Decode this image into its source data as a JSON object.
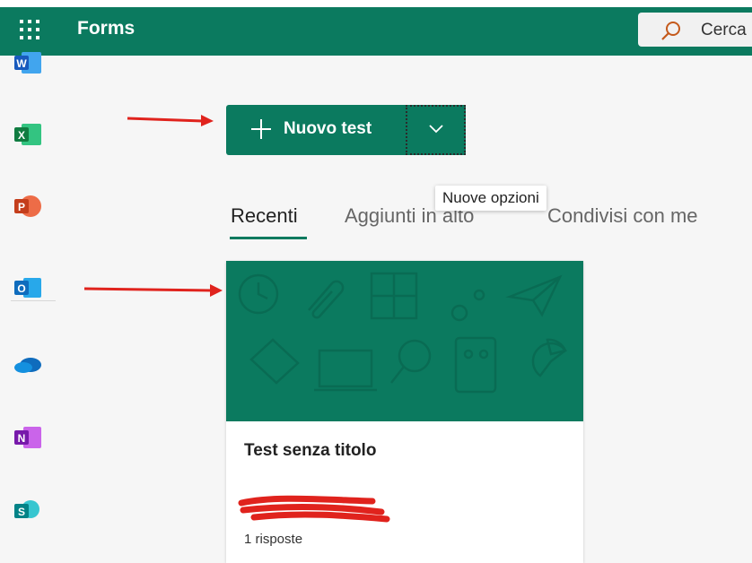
{
  "app": {
    "title": "Forms"
  },
  "search": {
    "label": "Cerca"
  },
  "rail": {
    "apps": [
      {
        "name": "word",
        "letter": "W",
        "color": "#185abd"
      },
      {
        "name": "excel",
        "letter": "X",
        "color": "#107c41"
      },
      {
        "name": "powerpoint",
        "letter": "P",
        "color": "#c43e1c"
      },
      {
        "name": "outlook",
        "letter": "O",
        "color": "#0f6cbd"
      },
      {
        "name": "onedrive",
        "letter": "",
        "color": "#0f6cbd"
      },
      {
        "name": "onenote",
        "letter": "N",
        "color": "#7719aa"
      },
      {
        "name": "sharepoint",
        "letter": "S",
        "color": "#038387"
      }
    ]
  },
  "toolbar": {
    "new_test_label": "Nuovo test",
    "more_options_tooltip": "Nuove opzioni"
  },
  "tabs": [
    {
      "label": "Recenti",
      "active": true
    },
    {
      "label": "Aggiunti in alto",
      "active": false
    },
    {
      "label": "Condivisi con me",
      "active": false
    }
  ],
  "card": {
    "title": "Test senza titolo",
    "responses": "1 risposte"
  },
  "colors": {
    "brand": "#0b7a5f",
    "annotation": "#e0231d"
  }
}
